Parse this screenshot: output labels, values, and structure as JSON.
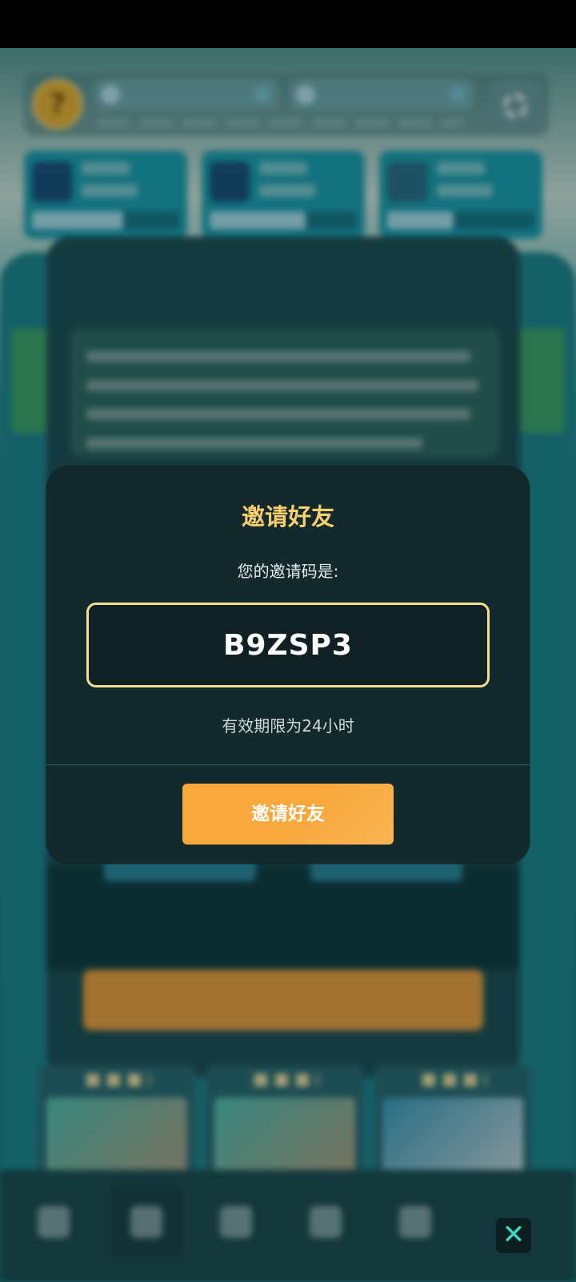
{
  "modal": {
    "title": "邀请好友",
    "prompt": "您的邀请码是:",
    "invite_code": "B9ZSP3",
    "validity": "有效期限为24小时",
    "button_label": "邀请好友"
  },
  "close": {
    "glyph": "✕",
    "icon": "close-icon"
  },
  "colors": {
    "title": "#f7cf6f",
    "code_border": "#f6dc8c",
    "button": "#f8a83c",
    "modal_bg": "#13292b",
    "close_glyph": "#35e0c8"
  },
  "background": {
    "avatar_glyph": "?",
    "icons": [
      "drop-icon",
      "gear-icon",
      "mountain-icon",
      "card-icon",
      "compass-icon",
      "diamond-icon",
      "heart-icon"
    ]
  }
}
